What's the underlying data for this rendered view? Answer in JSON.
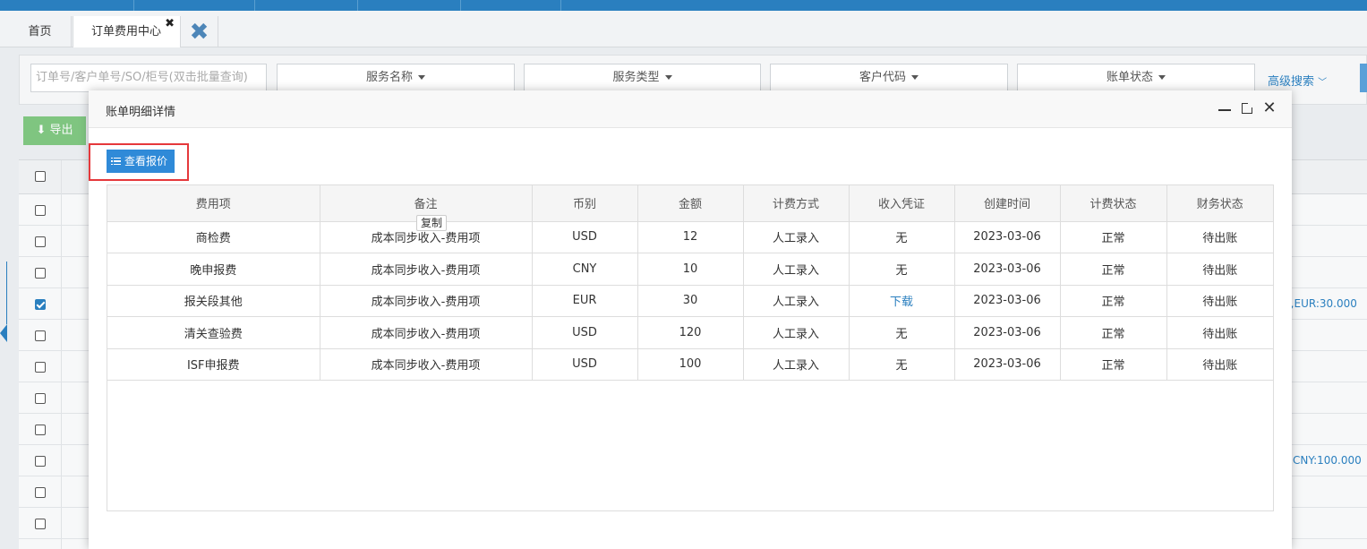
{
  "tabs": {
    "home": "首页",
    "active": "订单费用中心"
  },
  "search": {
    "placeholder": "订单号/客户单号/SO/柜号(双击批量查询)",
    "filters": [
      "服务名称",
      "服务类型",
      "客户代码",
      "账单状态"
    ],
    "advanced": "高级搜索"
  },
  "toolbar": {
    "export": "导出"
  },
  "background": {
    "row4_text": "),EUR:30.000",
    "row9_text": "CNY:100.000"
  },
  "dialog": {
    "title": "账单明细详情",
    "view_quote": "查看报价",
    "tooltip": "复制",
    "columns": [
      "费用项",
      "备注",
      "币别",
      "金额",
      "计费方式",
      "收入凭证",
      "创建时间",
      "计费状态",
      "财务状态"
    ],
    "rows": [
      [
        "商检费",
        "成本同步收入-费用项",
        "USD",
        "12",
        "人工录入",
        "无",
        "2023-03-06",
        "正常",
        "待出账"
      ],
      [
        "晚申报费",
        "成本同步收入-费用项",
        "CNY",
        "10",
        "人工录入",
        "无",
        "2023-03-06",
        "正常",
        "待出账"
      ],
      [
        "报关段其他",
        "成本同步收入-费用项",
        "EUR",
        "30",
        "人工录入",
        "下载",
        "2023-03-06",
        "正常",
        "待出账"
      ],
      [
        "清关查验费",
        "成本同步收入-费用项",
        "USD",
        "120",
        "人工录入",
        "无",
        "2023-03-06",
        "正常",
        "待出账"
      ],
      [
        "ISF申报费",
        "成本同步收入-费用项",
        "USD",
        "100",
        "人工录入",
        "无",
        "2023-03-06",
        "正常",
        "待出账"
      ]
    ]
  },
  "colors": {
    "accent": "#2f8ad8",
    "highlight": "#e5383b",
    "link": "#2a7fbf"
  }
}
